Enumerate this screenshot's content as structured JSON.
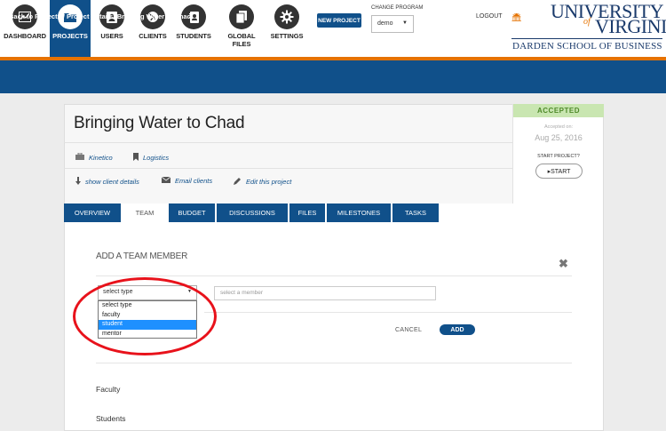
{
  "nav": {
    "items": [
      {
        "label": "DASHBOARD",
        "icon": "chart-icon"
      },
      {
        "label": "PROJECTS",
        "icon": "folder-icon"
      },
      {
        "label": "USERS",
        "icon": "contact-card-icon"
      },
      {
        "label": "CLIENTS",
        "icon": "globe-icon"
      },
      {
        "label": "STUDENTS",
        "icon": "address-book-icon"
      },
      {
        "label": "GLOBAL FILES",
        "icon": "files-icon"
      },
      {
        "label": "SETTINGS",
        "icon": "gear-icon"
      }
    ],
    "new_project": "NEW PROJECT",
    "change_program_label": "CHANGE PROGRAM",
    "program_value": "demo",
    "logout": "LOGOUT"
  },
  "logo": {
    "line1": "UNIVERSITY",
    "of": "of",
    "line2": "VIRGINIA",
    "school": "DARDEN SCHOOL OF BUSINESS"
  },
  "breadcrumb": "Back to Projects / Project Details: Bringing Water to Chad",
  "project": {
    "title": "Bringing Water to Chad",
    "client": "Kinetico",
    "category": "Logistics",
    "show_client_details": "show client details",
    "email_clients": "Email clients",
    "edit_project": "Edit this project",
    "status": "ACCEPTED",
    "accepted_on_label": "Accepted on:",
    "accepted_date": "Aug 25, 2016",
    "start_project_label": "START PROJECT?",
    "start_button": "▸START"
  },
  "tabs": [
    {
      "label": "OVERVIEW",
      "active": false
    },
    {
      "label": "TEAM",
      "active": true
    },
    {
      "label": "BUDGET",
      "active": false
    },
    {
      "label": "DISCUSSIONS",
      "active": false
    },
    {
      "label": "FILES",
      "active": false
    },
    {
      "label": "MILESTONES",
      "active": false
    },
    {
      "label": "TASKS",
      "active": false
    }
  ],
  "team_form": {
    "title": "ADD A TEAM MEMBER",
    "type_select_value": "select type",
    "member_placeholder": "select a member",
    "options": [
      "select type",
      "faculty",
      "student",
      "mentor"
    ],
    "highlighted_option": "student",
    "cancel": "CANCEL",
    "add": "ADD"
  },
  "sections": {
    "faculty": "Faculty",
    "students": "Students"
  },
  "colors": {
    "brand_blue": "#10508a",
    "accent_orange": "#e57200",
    "accepted_green": "#c9e6b1",
    "annotation_red": "#e8121b"
  }
}
